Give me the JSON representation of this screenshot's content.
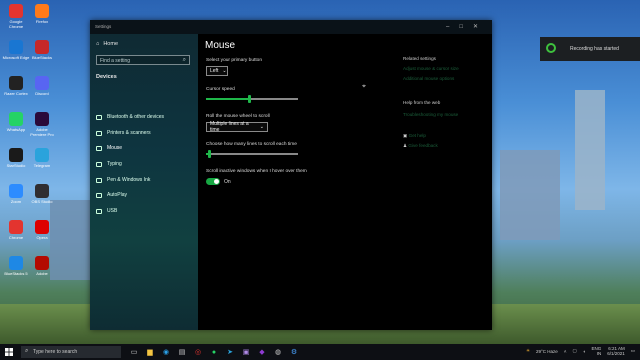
{
  "desktop": {
    "icons": [
      {
        "label": "Google Chrome",
        "color": "#e3342f"
      },
      {
        "label": "Firefox",
        "color": "#ff7a1a"
      },
      {
        "label": "Microsoft Edge",
        "color": "#1976d2"
      },
      {
        "label": "BlueStacks",
        "color": "#c62828"
      },
      {
        "label": "Razer Cortex",
        "color": "#222222"
      },
      {
        "label": "Discord",
        "color": "#5865f2"
      },
      {
        "label": "WhatsApp",
        "color": "#25d366"
      },
      {
        "label": "Adobe Premiere Pro",
        "color": "#2a0a3a"
      },
      {
        "label": "StarStudio",
        "color": "#1a1a1a"
      },
      {
        "label": "Telegram",
        "color": "#2aa3dc"
      },
      {
        "label": "Zoom",
        "color": "#2d8cff"
      },
      {
        "label": "OBS Studio",
        "color": "#302e31"
      },
      {
        "label": "Chrome",
        "color": "#e3342f"
      },
      {
        "label": "Opera",
        "color": "#d00"
      },
      {
        "label": "BlueStacks 5",
        "color": "#1e88e5"
      },
      {
        "label": "Adobe",
        "color": "#b30b00"
      }
    ]
  },
  "window": {
    "title": "Settings",
    "controls": [
      "–",
      "□",
      "✕"
    ],
    "sidebar": {
      "home": "Home",
      "search_placeholder": "Find a setting",
      "section": "Devices",
      "items": [
        {
          "label": "Bluetooth & other devices",
          "icon": "bluetooth-icon"
        },
        {
          "label": "Printers & scanners",
          "icon": "printer-icon"
        },
        {
          "label": "Mouse",
          "icon": "mouse-icon"
        },
        {
          "label": "Typing",
          "icon": "keyboard-icon"
        },
        {
          "label": "Pen & Windows Ink",
          "icon": "pen-icon"
        },
        {
          "label": "AutoPlay",
          "icon": "autoplay-icon"
        },
        {
          "label": "USB",
          "icon": "usb-icon"
        }
      ]
    },
    "content": {
      "title": "Mouse",
      "primary_button_label": "Select your primary button",
      "primary_button_value": "Left",
      "cursor_speed_label": "Cursor speed",
      "cursor_speed_level": 0.47,
      "scroll_wheel_label": "Roll the mouse wheel to scroll",
      "scroll_wheel_value": "Multiple lines at a time",
      "lines_label": "Choose how many lines to scroll each time",
      "lines_level": 0.03,
      "inactive_label": "Scroll inactive windows when I hover over them",
      "inactive_state": "On",
      "related_title": "Related settings",
      "related_links": [
        "Adjust mouse & cursor size",
        "Additional mouse options"
      ],
      "help_title": "Help from the web",
      "help_links": [
        "Troubleshooting my mouse"
      ],
      "get_help": "Get help",
      "give_feedback": "Give feedback"
    }
  },
  "taskbar": {
    "search_placeholder": "Type here to search",
    "weather": "29°C Haze",
    "language": "ENG",
    "language_sub": "IN",
    "time": "6:21 AM",
    "date": "6/1/2021"
  },
  "toast": {
    "message": "Recording has started"
  }
}
